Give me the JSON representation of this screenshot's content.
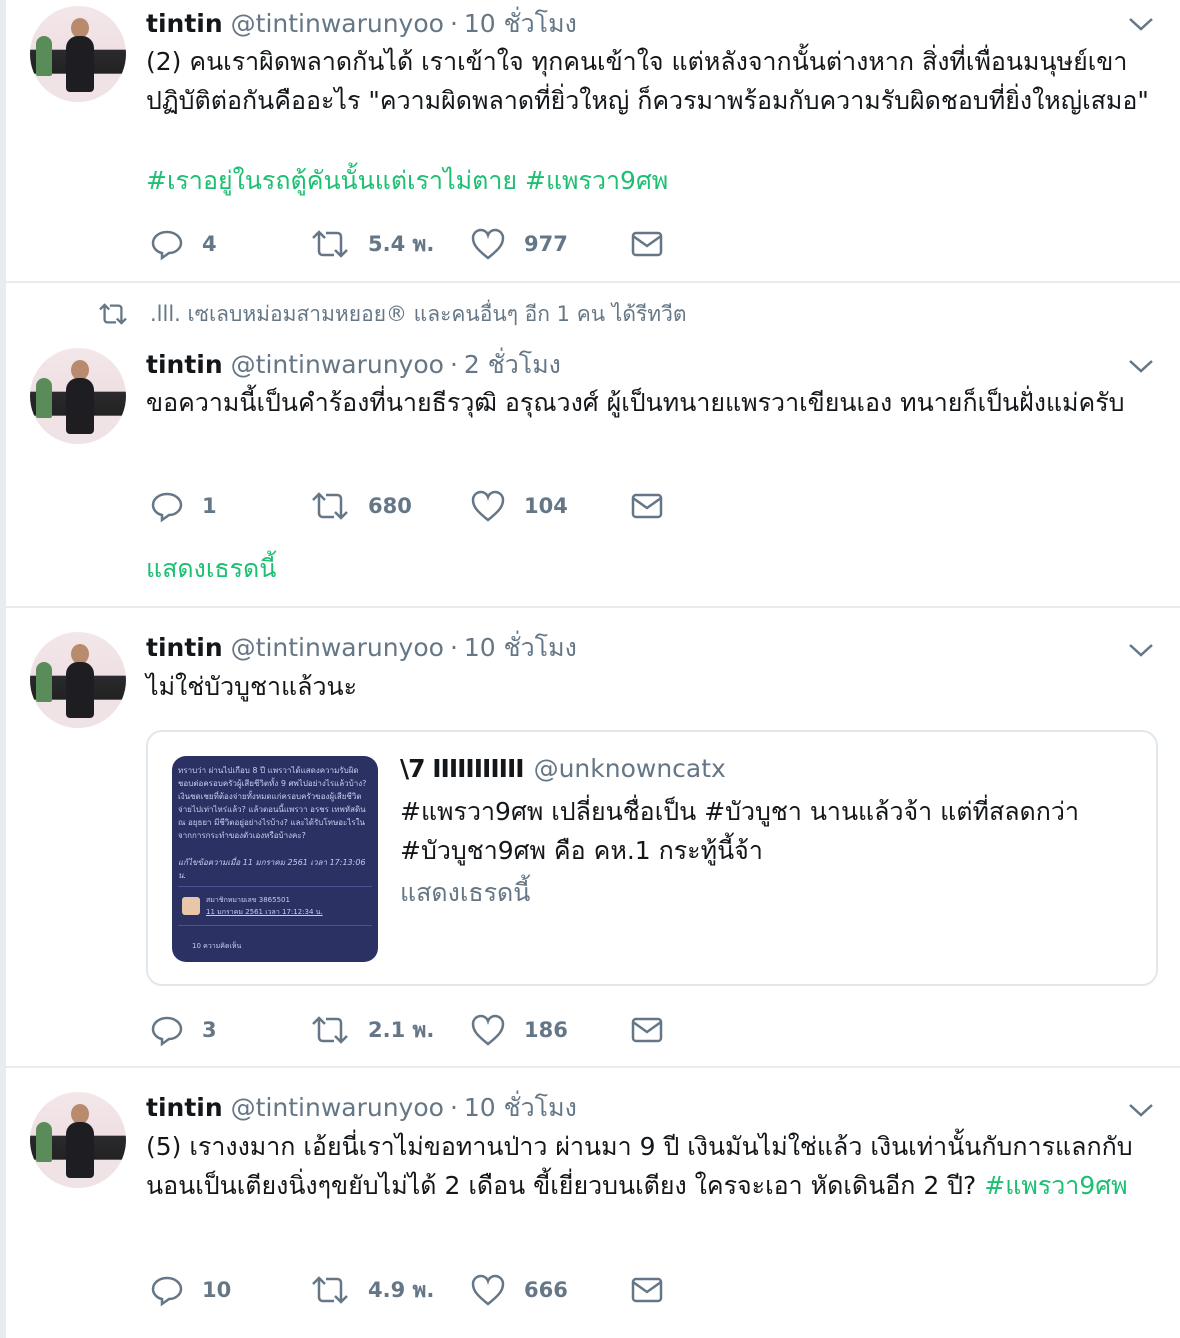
{
  "tweets": [
    {
      "name": "tintin",
      "handle": "@tintinwarunyoo",
      "time": "10 ชั่วโมง",
      "text": "(2) คนเราผิดพลาดกันได้  เราเข้าใจ ทุกคนเข้าใจ แต่หลังจากนั้นต่างหาก  สิ่งที่เพื่อนมนุษย์เขาปฏิบัติต่อกันคืออะไร \"ความผิดพลาดที่ยิ่วใหญ่ ก็ควรมาพร้อมกับความรับผิดชอบที่ยิ่งใหญ่เสมอ\"",
      "hashtags": "#เราอยู่ในรถตู้คันนั้นแต่เราไม่ตาย #แพรวา9ศพ",
      "replies": "4",
      "retweets": "5.4 พ.",
      "likes": "977"
    },
    {
      "retweet_note": ".lll. เซเลบหม่อมสามหยอย® และคนอื่นๆ อีก 1 คน ได้รีทวีต",
      "name": "tintin",
      "handle": "@tintinwarunyoo",
      "time": "2 ชั่วโมง",
      "text": "ขอความนี้เป็นคำร้องที่นายธีรวุฒิ อรุณวงศ์ ผู้เป็นทนายแพรวาเขียนเอง ทนายก็เป็นฝั่งแม่ครับ",
      "replies": "1",
      "retweets": "680",
      "likes": "104",
      "show_thread": "แสดงเธรดนี้"
    },
    {
      "name": "tintin",
      "handle": "@tintinwarunyoo",
      "time": "10 ชั่วโมง",
      "text": "ไม่ใช่บัวบูชาแล้วนะ",
      "quote": {
        "name": "\\7 IIIIIIIIIII",
        "handle": "@unknowncatx",
        "text_line1": "#แพรวา9ศพ เปลี่ยนชื่อเป็น #บัวบูชา นานแล้วจ้า แต่ที่สลดกว่า",
        "text_line2": "#บัวบูชา9ศพ คือ คห.1 กระทู้นี้จ้า",
        "show_thread": "แสดงเธรดนี้",
        "image_text": "ทราบว่า ผ่านไปเกือบ 8 ปี แพรวาได้แสดงความรับผิดชอบต่อครอบครัวผู้เสียชีวิตทั้ง 9 ศพไปอย่างไรแล้วบ้าง? เงินชดเชยที่ต้องจ่ายทั้งหมดแก่ครอบครัวของผู้เสียชีวิต จ่ายไปเท่าไหร่แล้ว? แล้วตอนนี้แพรวา อรชร เทพหัสดิน ณ อยุธยา มีชีวิตอยู่อย่างไรบ้าง? และได้รับโทษอะไรในจากการกระทำของตัวเองหรือบ้างคะ?",
        "image_edit": "แก้ไขข้อความเมื่อ 11 มกราคม 2561 เวลา 17:13:06 น.",
        "image_member": "สมาชิกหมายเลข 3865501",
        "image_date": "11 มกราคม 2561 เวลา 17:12:34 น.",
        "image_footer": "10 ความคิดเห็น"
      },
      "replies": "3",
      "retweets": "2.1 พ.",
      "likes": "186"
    },
    {
      "name": "tintin",
      "handle": "@tintinwarunyoo",
      "time": "10 ชั่วโมง",
      "text_plain": "(5)  เรางงมาก เอ้ยนี่เราไม่ขอทานป่าว  ผ่านมา 9 ปี เงินมันไม่ใช่แล้ว เงินเท่านั้นกับการแลกกับนอนเป็นเตียงนิ่งๆขยับไม่ได้ 2 เดือน ขี้เยี่ยวบนเตียง ใครจะเอา หัดเดินอีก 2 ปี? ",
      "hashtag": "#แพรวา9ศพ",
      "replies": "10",
      "retweets": "4.9 พ.",
      "likes": "666"
    }
  ],
  "colors": {
    "hashtag": "#1dbf73",
    "muted": "#657786",
    "divider": "#e6ecf0"
  },
  "icons": [
    "reply-icon",
    "retweet-icon",
    "like-icon",
    "message-icon",
    "chevron-down-icon"
  ]
}
